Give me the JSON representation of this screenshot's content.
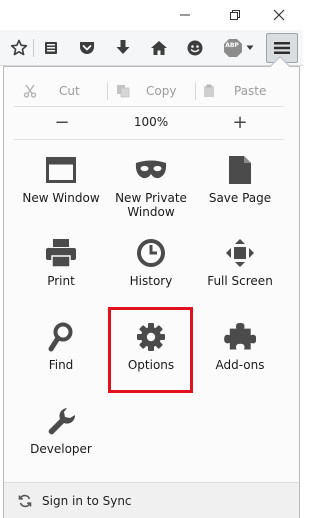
{
  "window": {
    "minimize_glyph": "—",
    "maximize_glyph": "❐",
    "close_glyph": "✕"
  },
  "toolbar": {
    "buttons": [
      "bookmark-star-icon",
      "reading-list-icon",
      "pocket-icon",
      "downloads-icon",
      "home-icon",
      "hello-icon",
      "adblock-plus-icon"
    ],
    "abp_badge": "ABP"
  },
  "menu": {
    "edit": {
      "cut_label": "Cut",
      "copy_label": "Copy",
      "paste_label": "Paste"
    },
    "zoom": {
      "minus_label": "−",
      "level": "100%",
      "plus_label": "+"
    },
    "items": [
      {
        "label": "New Window",
        "icon": "new-window-icon"
      },
      {
        "label": "New Private\nWindow",
        "icon": "private-mask-icon"
      },
      {
        "label": "Save Page",
        "icon": "save-page-icon"
      },
      {
        "label": "Print",
        "icon": "printer-icon"
      },
      {
        "label": "History",
        "icon": "clock-icon"
      },
      {
        "label": "Full Screen",
        "icon": "fullscreen-icon"
      },
      {
        "label": "Find",
        "icon": "magnifier-icon"
      },
      {
        "label": "Options",
        "icon": "gear-icon"
      },
      {
        "label": "Add-ons",
        "icon": "puzzle-icon"
      },
      {
        "label": "Developer",
        "icon": "wrench-icon"
      }
    ],
    "sync_label": "Sign in to Sync"
  },
  "colors": {
    "highlight": "#e3101d",
    "icon_gray": "#4b4b4b"
  }
}
